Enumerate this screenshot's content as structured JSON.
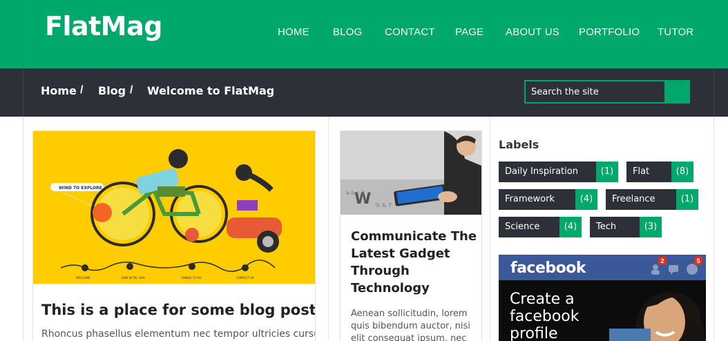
{
  "site": {
    "logo": "FlatMag"
  },
  "nav": {
    "items": [
      {
        "label": "HOME"
      },
      {
        "label": "BLOG"
      },
      {
        "label": "CONTACT"
      },
      {
        "label": "PAGE"
      },
      {
        "label": "ABOUT US"
      },
      {
        "label": "PORTFOLIO"
      },
      {
        "label": "TUTOR"
      }
    ]
  },
  "breadcrumb": {
    "home": "Home",
    "blog": "Blog",
    "current": "Welcome to FlatMag",
    "separator": "/"
  },
  "search": {
    "placeholder": "Search the site"
  },
  "posts": [
    {
      "title": "This is a place for some blog post title",
      "excerpt": "Rhoncus phasellus elementum nec tempor ultricies cursus",
      "illustration_texts": [
        "WIND TO EXPLORE",
        "WELCOME",
        "RIDE IN TEL AVIV",
        "THINGS TO DO",
        "CONTACT US"
      ]
    },
    {
      "title": "Communicate The Latest Gadget Through Technology",
      "excerpt": "Aenean sollicitudin, lorem quis bibendum auctor, nisi elit consequat ipsum, nec"
    }
  ],
  "sidebar": {
    "labels_title": "Labels",
    "labels": [
      {
        "name": "Daily Inspiration",
        "count": "(1)"
      },
      {
        "name": "Flat",
        "count": "(8)"
      },
      {
        "name": "Framework",
        "count": "(4)"
      },
      {
        "name": "Freelance",
        "count": "(1)"
      },
      {
        "name": "Science",
        "count": "(4)"
      },
      {
        "name": "Tech",
        "count": "(3)"
      }
    ],
    "facebook": {
      "brand": "facebook",
      "headline_1": "Create a",
      "headline_2": "facebook",
      "headline_3": "profile",
      "friend_badge": "2",
      "notif_badge": "5"
    }
  },
  "colors": {
    "accent": "#00a86b",
    "dark": "#2d3039",
    "facebook": "#3b5998",
    "illustration_bg": "#ffcc00"
  }
}
